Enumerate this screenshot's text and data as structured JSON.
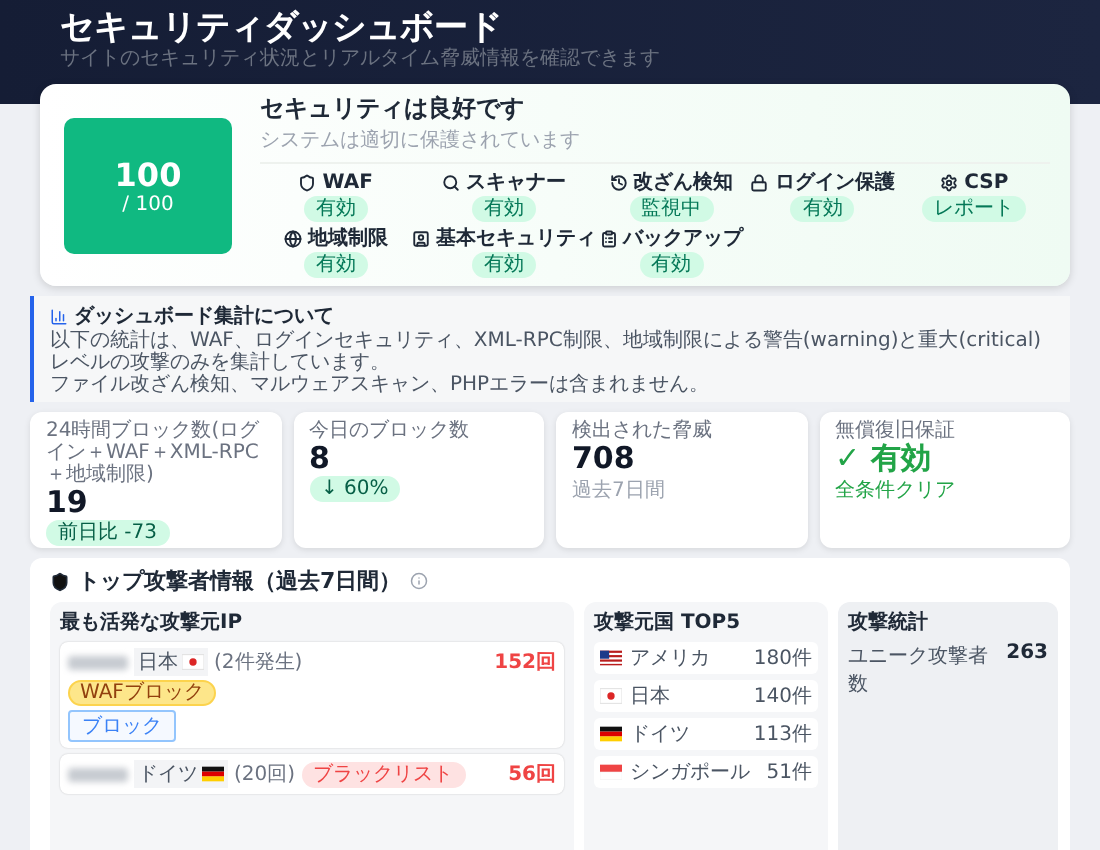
{
  "header": {
    "title": "セキュリティダッシュボード",
    "subtitle": "サイトのセキュリティ状況とリアルタイム脅威情報を確認できます"
  },
  "score": {
    "value": "100",
    "max": "/ 100",
    "title": "セキュリティは良好です",
    "subtitle": "システムは適切に保護されています",
    "features": [
      {
        "label": "WAF",
        "status": "有効"
      },
      {
        "label": "スキャナー",
        "status": "有効"
      },
      {
        "label": "改ざん検知",
        "status": "監視中"
      },
      {
        "label": "ログイン保護",
        "status": "有効"
      },
      {
        "label": "CSP",
        "status": "レポート"
      },
      {
        "label": "地域制限",
        "status": "有効"
      },
      {
        "label": "基本セキュリティ",
        "status": "有効"
      },
      {
        "label": "バックアップ",
        "status": "有効"
      }
    ]
  },
  "info": {
    "title": "ダッシュボード集計について",
    "lines": [
      "以下の統計は、WAF、ログインセキュリティ、XML-RPC制限、地域制限による警告(warning)と重大(critical)レベルの攻撃のみを集計しています。",
      "ファイル改ざん検知、マルウェアスキャン、PHPエラーは含まれません。"
    ]
  },
  "stats": [
    {
      "kind": "delta",
      "label": "24時間ブロック数(ログイン＋WAF＋XML-RPC＋地域制限)",
      "value": "19",
      "note": "前日比 -73"
    },
    {
      "kind": "delta",
      "label": "今日のブロック数",
      "value": "8",
      "note": "↓ 60%"
    },
    {
      "kind": "note",
      "label": "検出された脅威",
      "value": "708",
      "note": "過去7日間"
    },
    {
      "kind": "status",
      "label": "無償復旧保証",
      "value": "✓ 有効",
      "note": "全条件クリア"
    }
  ],
  "attackers": {
    "title": "トップ攻撃者情報（過去7日間）",
    "ips_title": "最も活発な攻撃元IP",
    "ips": [
      {
        "country": "日本",
        "kind": "jp",
        "note": "(2件発生)",
        "count": "152回",
        "tags": [
          {
            "kind": "warn",
            "label": "WAFブロック"
          }
        ],
        "action": "ブロック"
      },
      {
        "country": "ドイツ",
        "kind": "de",
        "note": "(20回)",
        "count": "56回",
        "tags": [
          {
            "kind": "danger",
            "label": "ブラックリスト"
          }
        ]
      }
    ],
    "countries_title": "攻撃元国 TOP5",
    "countries": [
      {
        "kind": "us",
        "name": "アメリカ",
        "count": "180件"
      },
      {
        "kind": "jp",
        "name": "日本",
        "count": "140件"
      },
      {
        "kind": "de",
        "name": "ドイツ",
        "count": "113件"
      },
      {
        "kind": "sg",
        "name": "シンガポール",
        "count": "51件"
      }
    ],
    "stats_title": "攻撃統計",
    "stats": [
      {
        "label": "ユニーク攻撃者数",
        "value": "263"
      }
    ]
  }
}
